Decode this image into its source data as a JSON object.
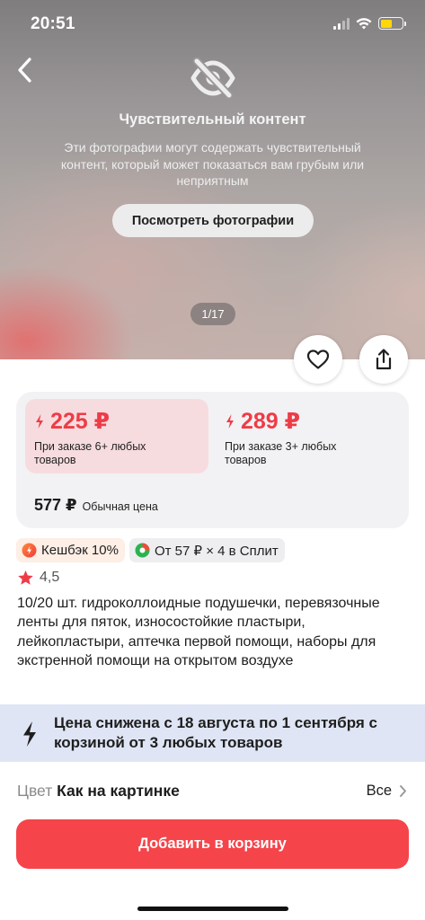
{
  "status_bar": {
    "time": "20:51",
    "battery_level": 0.55,
    "battery_color": "#ffd60a"
  },
  "gallery": {
    "sensitive_title": "Чувствительный контент",
    "sensitive_description": "Эти фотографии могут содержать чувствительный контент, который может показаться вам грубым или неприятным",
    "view_button_label": "Посмотреть фотографии",
    "counter": "1/17",
    "icons": {
      "back": "chevron-left-icon",
      "hidden": "eye-slash-icon",
      "favorite": "heart-icon",
      "share": "share-icon"
    }
  },
  "prices": {
    "tiers": [
      {
        "price": "225 ₽",
        "note": "При заказе 6+ любых товаров",
        "highlighted": true
      },
      {
        "price": "289 ₽",
        "note": "При заказе 3+ любых товаров",
        "highlighted": false
      }
    ],
    "regular_price": "577 ₽",
    "regular_label": "Обычная цена",
    "accent_color": "#ee3c47"
  },
  "badges": {
    "cashback": "Кешбэк 10%",
    "split": "От 57 ₽ × 4 в Сплит"
  },
  "rating": "4,5",
  "product_title": "10/20 шт. гидроколлоидные подушечки, перевязочные ленты для пяток, износостойкие пластыри, лейкопластыри, аптечка первой помощи, наборы для экстренной помощи на открытом воздухе",
  "promo": {
    "text": "Цена снижена с 18 августа по 1 сентября с корзиной от 3 любых товаров"
  },
  "color_selector": {
    "label": "Цвет",
    "value": "Как на картинке",
    "all_label": "Все"
  },
  "cart": {
    "button_label": "Добавить в корзину",
    "button_color": "#f5444a"
  }
}
